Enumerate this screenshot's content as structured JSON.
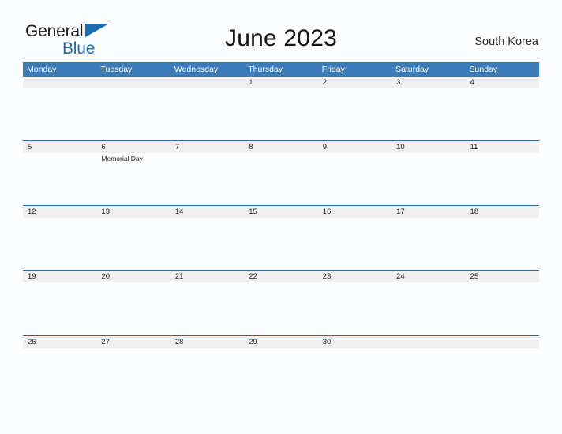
{
  "brand": {
    "line1": "General",
    "line2": "Blue",
    "accent_color": "#1f6bb0",
    "triangle_icon": "triangle-icon"
  },
  "header": {
    "title": "June 2023",
    "country": "South Korea"
  },
  "calendar": {
    "header_color": "#3c7cb8",
    "separator_color": "#2b6ca8",
    "date_band_color": "#f0f0f0",
    "weekdays": [
      "Monday",
      "Tuesday",
      "Wednesday",
      "Thursday",
      "Friday",
      "Saturday",
      "Sunday"
    ],
    "weeks": [
      {
        "days": [
          {
            "date": "",
            "events": []
          },
          {
            "date": "",
            "events": []
          },
          {
            "date": "",
            "events": []
          },
          {
            "date": "1",
            "events": []
          },
          {
            "date": "2",
            "events": []
          },
          {
            "date": "3",
            "events": []
          },
          {
            "date": "4",
            "events": []
          }
        ]
      },
      {
        "days": [
          {
            "date": "5",
            "events": []
          },
          {
            "date": "6",
            "events": [
              "Memorial Day"
            ]
          },
          {
            "date": "7",
            "events": []
          },
          {
            "date": "8",
            "events": []
          },
          {
            "date": "9",
            "events": []
          },
          {
            "date": "10",
            "events": []
          },
          {
            "date": "11",
            "events": []
          }
        ]
      },
      {
        "days": [
          {
            "date": "12",
            "events": []
          },
          {
            "date": "13",
            "events": []
          },
          {
            "date": "14",
            "events": []
          },
          {
            "date": "15",
            "events": []
          },
          {
            "date": "16",
            "events": []
          },
          {
            "date": "17",
            "events": []
          },
          {
            "date": "18",
            "events": []
          }
        ]
      },
      {
        "days": [
          {
            "date": "19",
            "events": []
          },
          {
            "date": "20",
            "events": []
          },
          {
            "date": "21",
            "events": []
          },
          {
            "date": "22",
            "events": []
          },
          {
            "date": "23",
            "events": []
          },
          {
            "date": "24",
            "events": []
          },
          {
            "date": "25",
            "events": []
          }
        ]
      },
      {
        "days": [
          {
            "date": "26",
            "events": []
          },
          {
            "date": "27",
            "events": []
          },
          {
            "date": "28",
            "events": []
          },
          {
            "date": "29",
            "events": []
          },
          {
            "date": "30",
            "events": []
          },
          {
            "date": "",
            "events": []
          },
          {
            "date": "",
            "events": []
          }
        ]
      }
    ]
  }
}
